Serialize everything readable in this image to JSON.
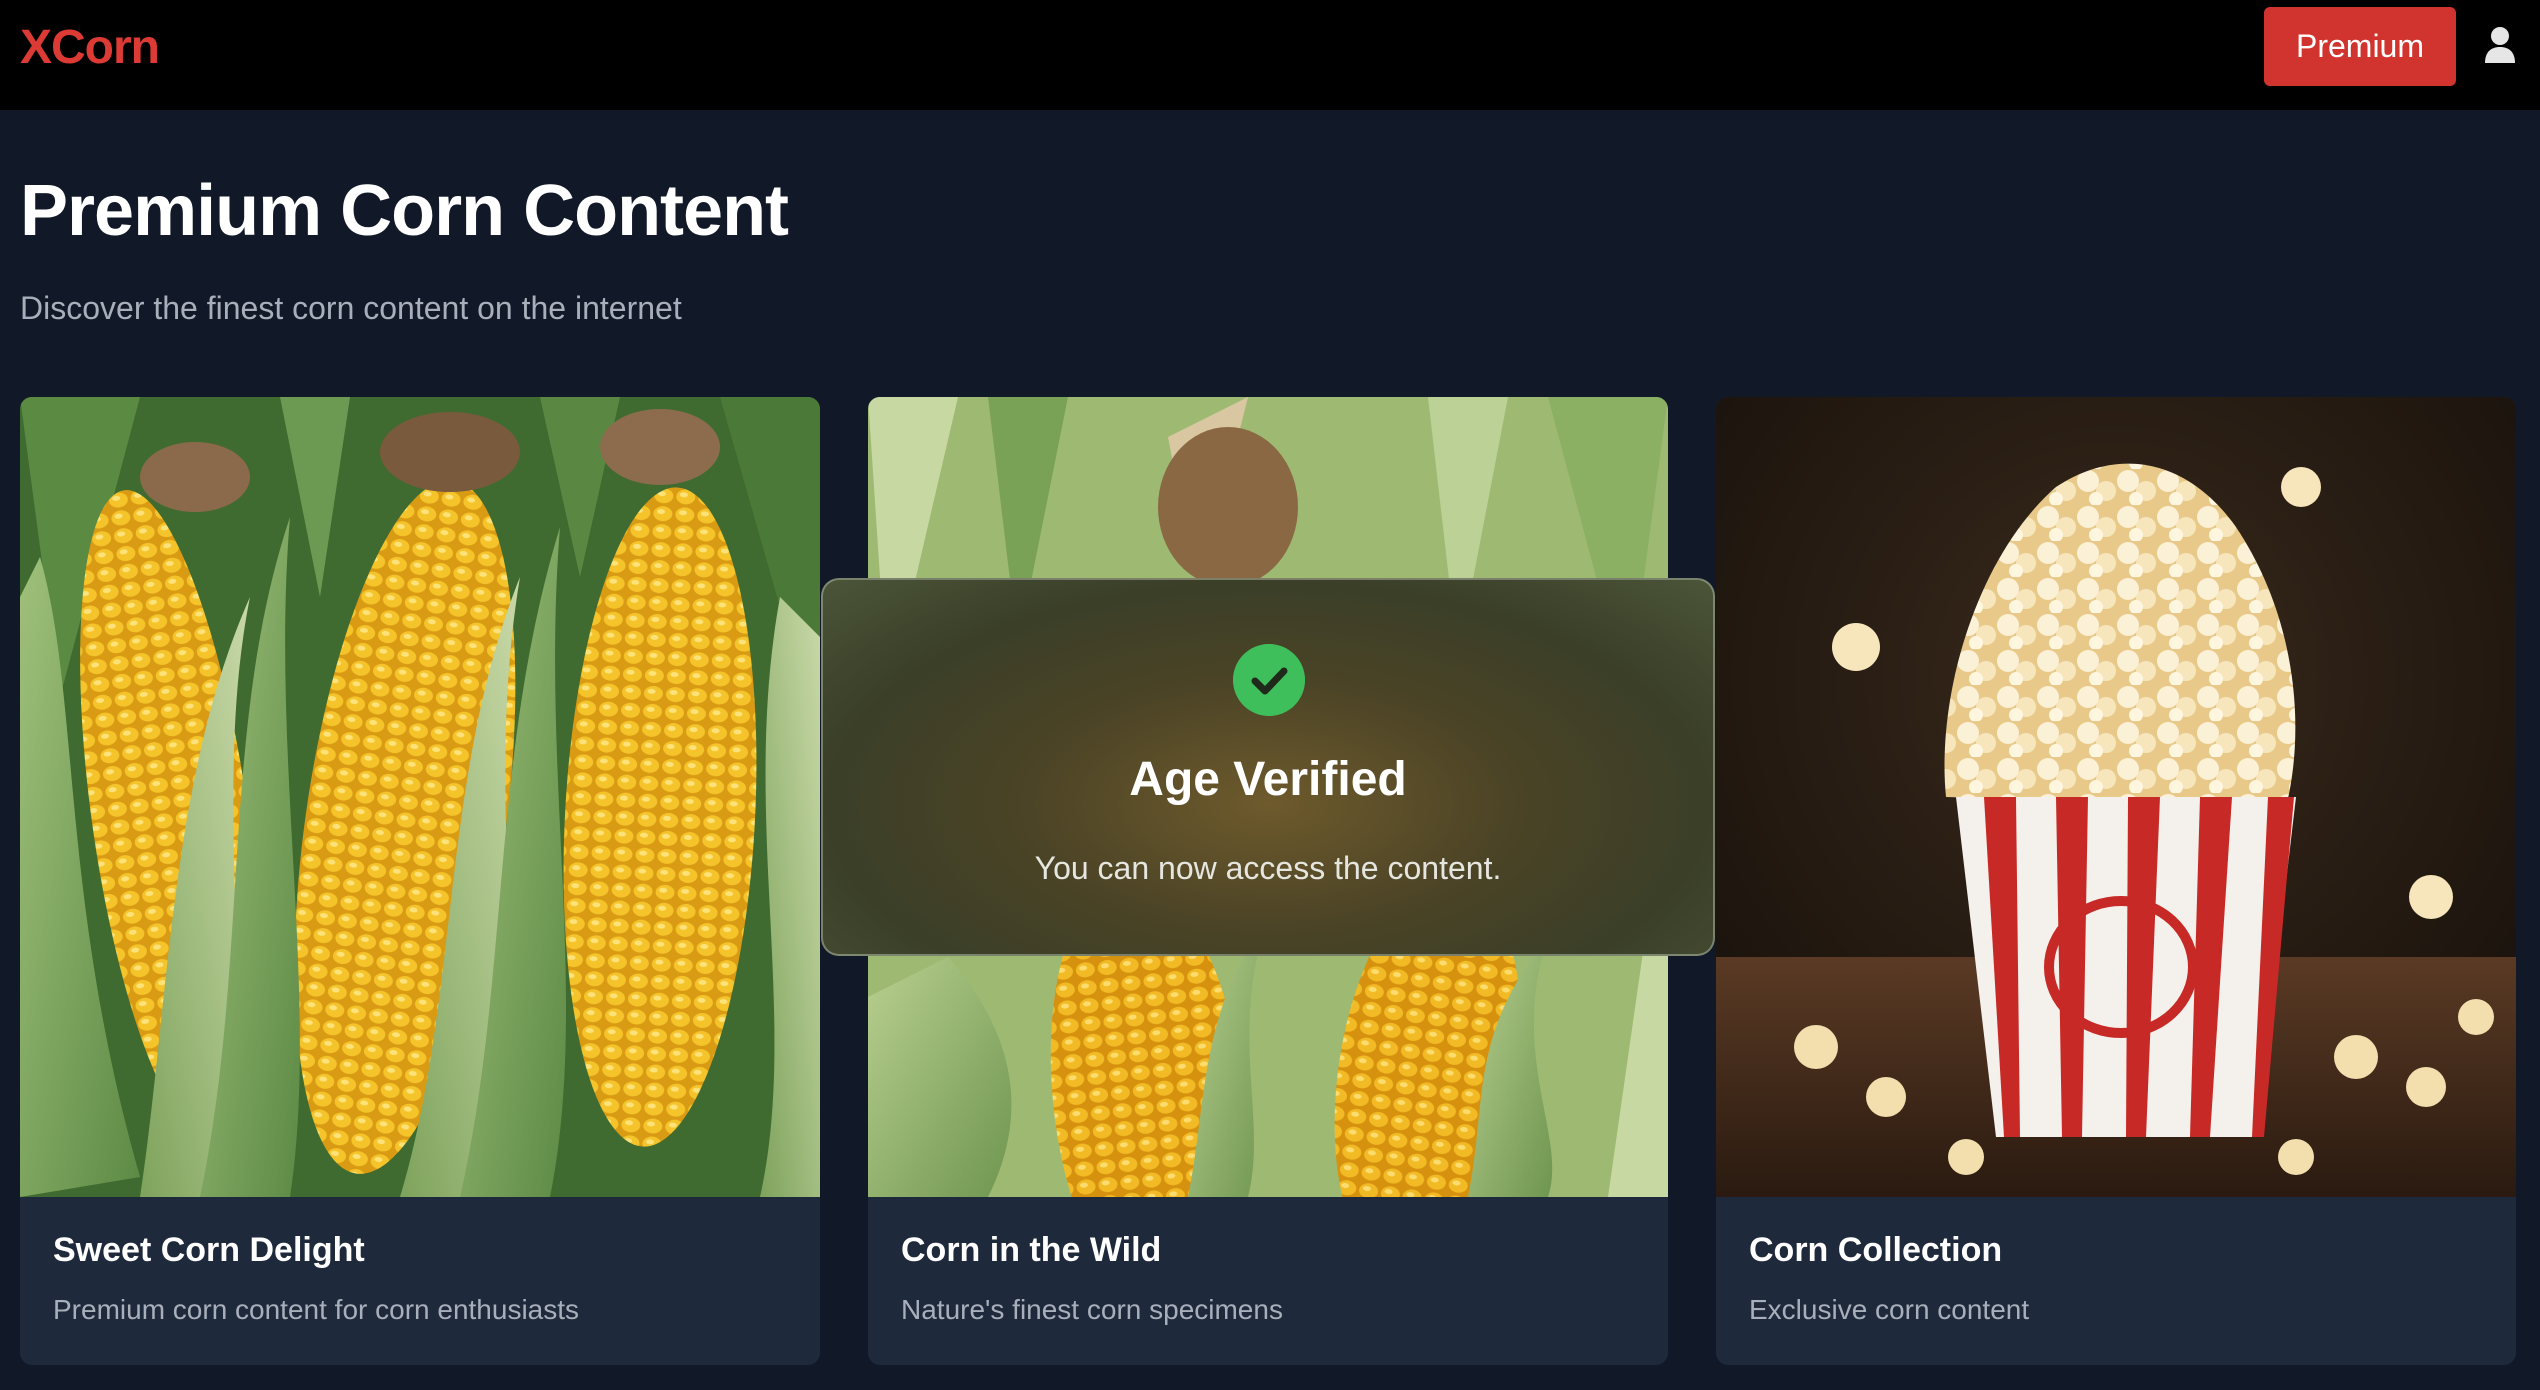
{
  "header": {
    "logo": "XCorn",
    "premium_label": "Premium",
    "user_icon": "user-icon"
  },
  "hero": {
    "title": "Premium Corn Content",
    "subtitle": "Discover the finest corn content on the internet"
  },
  "cards": [
    {
      "title": "Sweet Corn Delight",
      "description": "Premium corn content for corn enthusiasts",
      "image": "corn-cobs-in-husks"
    },
    {
      "title": "Corn in the Wild",
      "description": "Nature's finest corn specimens",
      "image": "corn-growing-in-field"
    },
    {
      "title": "Corn Collection",
      "description": "Exclusive corn content",
      "image": "popcorn-bucket"
    }
  ],
  "toast": {
    "icon": "check-circle-icon",
    "title": "Age Verified",
    "message": "You can now access the content."
  },
  "colors": {
    "brand": "#dc3a35",
    "background": "#111827",
    "card": "#1e293b",
    "success": "#3fbf5b"
  }
}
